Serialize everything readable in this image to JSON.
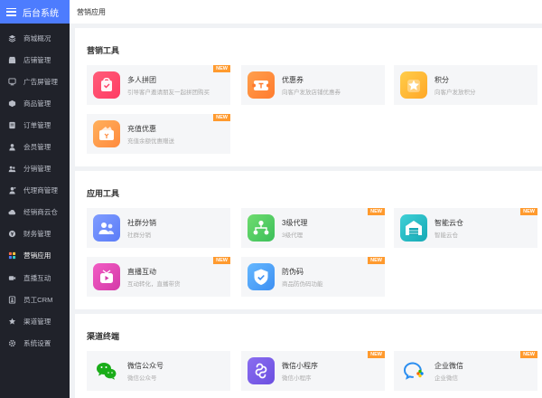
{
  "app": {
    "title": "后台系统"
  },
  "sidebar": {
    "items": [
      {
        "label": "商城概况",
        "icon": "stack-icon",
        "active": false
      },
      {
        "label": "店铺管理",
        "icon": "shop-icon",
        "active": false
      },
      {
        "label": "广告屏管理",
        "icon": "screen-icon",
        "active": false
      },
      {
        "label": "商品管理",
        "icon": "box-icon",
        "active": false
      },
      {
        "label": "订单管理",
        "icon": "order-icon",
        "active": false
      },
      {
        "label": "会员管理",
        "icon": "user-icon",
        "active": false
      },
      {
        "label": "分销管理",
        "icon": "distribution-icon",
        "active": false
      },
      {
        "label": "代理商管理",
        "icon": "agent-icon",
        "active": false
      },
      {
        "label": "经销商云仓",
        "icon": "cloud-icon",
        "active": false
      },
      {
        "label": "财务管理",
        "icon": "finance-icon",
        "active": false
      },
      {
        "label": "营销应用",
        "icon": "apps-icon",
        "active": true
      },
      {
        "label": "直播互动",
        "icon": "camera-icon",
        "active": false
      },
      {
        "label": "员工CRM",
        "icon": "crm-icon",
        "active": false
      },
      {
        "label": "渠道管理",
        "icon": "channel-icon",
        "active": false
      },
      {
        "label": "系统设置",
        "icon": "gear-icon",
        "active": false
      }
    ]
  },
  "header": {
    "title": "营销应用"
  },
  "sections": [
    {
      "title": "营销工具",
      "cards": [
        {
          "name": "多人拼团",
          "desc": "引导客户邀请朋友一起拼团购买",
          "icon": "group-buy-icon",
          "colors": [
            "#ff5e7a",
            "#ff3b63"
          ],
          "is_new": true
        },
        {
          "name": "优惠券",
          "desc": "向客户发放店铺优惠券",
          "icon": "coupon-icon",
          "colors": [
            "#ffa04d",
            "#ff7b2e"
          ],
          "is_new": false
        },
        {
          "name": "积分",
          "desc": "向客户发放积分",
          "icon": "points-icon",
          "colors": [
            "#ffcd4a",
            "#ffa726"
          ],
          "is_new": false
        },
        {
          "name": "充值优惠",
          "desc": "充值余额优惠赠送",
          "icon": "recharge-icon",
          "colors": [
            "#ffb05c",
            "#ff8a3d"
          ],
          "is_new": true
        }
      ]
    },
    {
      "title": "应用工具",
      "cards": [
        {
          "name": "社群分销",
          "desc": "社群分销",
          "icon": "community-icon",
          "colors": [
            "#7f9cff",
            "#5b7cf7"
          ],
          "is_new": false
        },
        {
          "name": "3级代理",
          "desc": "3级代理",
          "icon": "agent-tree-icon",
          "colors": [
            "#6fdc6f",
            "#3cbf5a"
          ],
          "is_new": true
        },
        {
          "name": "智能云仓",
          "desc": "智能云仓",
          "icon": "warehouse-icon",
          "colors": [
            "#3fd0d6",
            "#16a9b5"
          ],
          "is_new": true
        },
        {
          "name": "直播互动",
          "desc": "互动转化，直播带货",
          "icon": "live-icon",
          "colors": [
            "#f25cc4",
            "#d43aa8"
          ],
          "is_new": true
        },
        {
          "name": "防伪码",
          "desc": "商品防伪码功能",
          "icon": "shield-icon",
          "colors": [
            "#66b8ff",
            "#3d8ff2"
          ],
          "is_new": true
        }
      ]
    },
    {
      "title": "渠道终端",
      "cards": [
        {
          "name": "微信公众号",
          "desc": "微信公众号",
          "icon": "wechat-icon",
          "colors": [
            "#f5f6f8",
            "#f5f6f8"
          ],
          "is_new": false
        },
        {
          "name": "微信小程序",
          "desc": "微信小程序",
          "icon": "mini-program-icon",
          "colors": [
            "#8a6df0",
            "#6b4fe0"
          ],
          "is_new": true
        },
        {
          "name": "企业微信",
          "desc": "企业微信",
          "icon": "wecom-icon",
          "colors": [
            "#f5f6f8",
            "#f5f6f8"
          ],
          "is_new": true
        }
      ]
    }
  ],
  "badge_label": "NEW",
  "colors": {
    "sidebar_bg": "#20222a",
    "brand_bg": "#4d7cfe",
    "badge": "#ff9a2e"
  }
}
